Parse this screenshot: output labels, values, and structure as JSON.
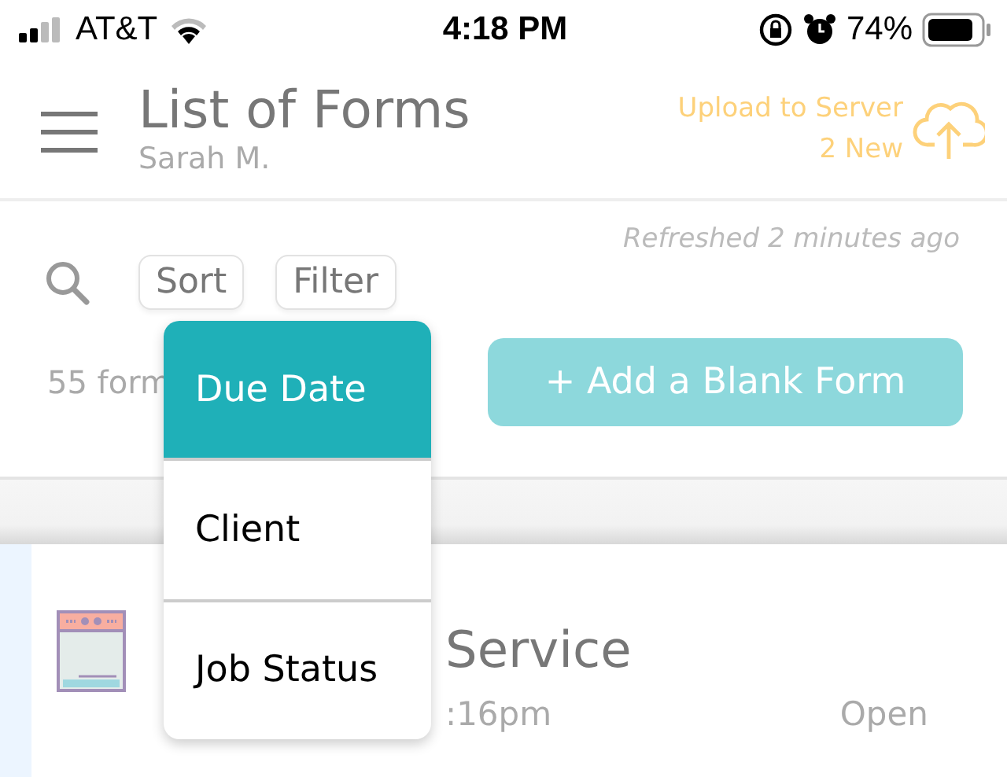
{
  "status_bar": {
    "carrier": "AT&T",
    "time": "4:18 PM",
    "battery": "74%"
  },
  "header": {
    "title": "List of Forms",
    "user": "Sarah M.",
    "upload_label": "Upload to Server",
    "upload_count": "2 New"
  },
  "toolbar": {
    "refreshed": "Refreshed 2 minutes ago",
    "sort_label": "Sort",
    "filter_label": "Filter",
    "form_count": "55 form",
    "add_button": "+ Add a Blank Form"
  },
  "sort_menu": {
    "expanded": true,
    "items": [
      {
        "label": "Due Date",
        "selected": true
      },
      {
        "label": "Client",
        "selected": false
      },
      {
        "label": "Job Status",
        "selected": false
      }
    ]
  },
  "form_card": {
    "title_end": "Service",
    "date_end": ":16pm",
    "status": "Open"
  }
}
